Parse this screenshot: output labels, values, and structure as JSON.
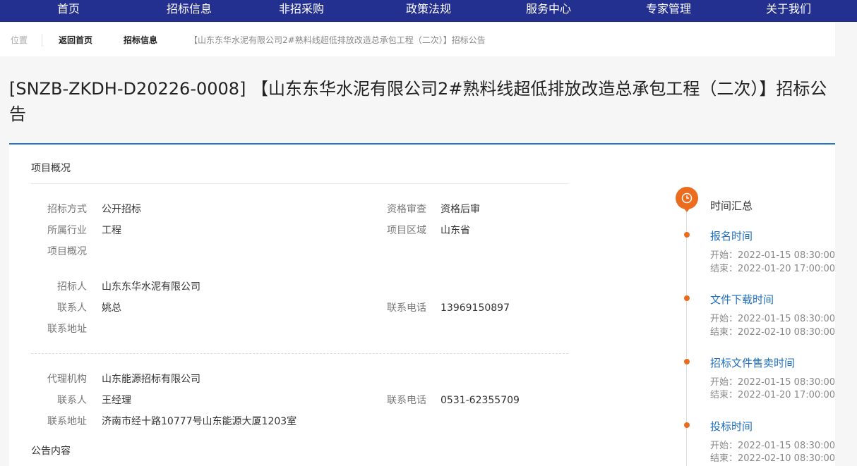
{
  "nav": [
    "首页",
    "招标信息",
    "非招采购",
    "政策法规",
    "服务中心",
    "专家管理",
    "关于我们"
  ],
  "breadcrumb": {
    "label": "位置",
    "home": "返回首页",
    "category": "招标信息",
    "current": "【山东东华水泥有限公司2#熟料线超低排放改造总承包工程（二次）】招标公告"
  },
  "title": "[SNZB-ZKDH-D20226-0008] 【山东东华水泥有限公司2#熟料线超低排放改造总承包工程（二次）】招标公告",
  "overview": {
    "heading": "项目概况",
    "method_label": "招标方式",
    "method": "公开招标",
    "qual_label": "资格审查",
    "qual": "资格后审",
    "industry_label": "所属行业",
    "industry": "工程",
    "region_label": "项目区域",
    "region": "山东省",
    "summary_label": "项目概况",
    "tenderer_label": "招标人",
    "tenderer": "山东东华水泥有限公司",
    "contact_label": "联系人",
    "contact": "姚总",
    "phone_label": "联系电话",
    "phone": "13969150897",
    "address_label": "联系地址",
    "agency_label": "代理机构",
    "agency": "山东能源招标有限公司",
    "agency_contact_label": "联系人",
    "agency_contact": "王经理",
    "agency_phone_label": "联系电话",
    "agency_phone": "0531-62355709",
    "agency_address_label": "联系地址",
    "agency_address": "济南市经十路10777号山东能源大厦1203室"
  },
  "content_heading": "公告内容",
  "timeline": {
    "heading": "时间汇总",
    "items": [
      {
        "title": "报名时间",
        "start": "开始：2022-01-15 08:30:00",
        "end": "结束：2022-01-20 17:00:00"
      },
      {
        "title": "文件下载时间",
        "start": "开始：2022-01-15 08:30:00",
        "end": "结束：2022-02-10 08:30:00"
      },
      {
        "title": "招标文件售卖时间",
        "start": "开始：2022-01-15 08:30:00",
        "end": "结束：2022-01-20 17:00:00"
      },
      {
        "title": "投标时间",
        "start": "开始：2022-01-15 08:30:00",
        "end": "结束：2022-02-10 08:30:00"
      }
    ]
  },
  "colors": {
    "nav_bg": "#23308f",
    "accent": "#2478c8",
    "timeline": "#ec6c1f"
  }
}
